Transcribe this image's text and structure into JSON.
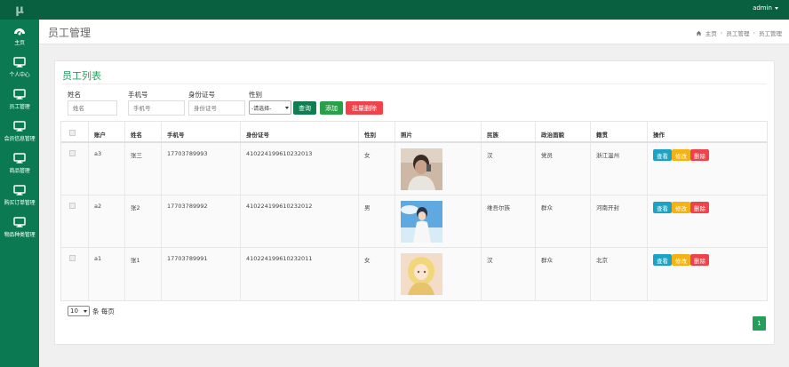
{
  "app": {
    "logo": "μ",
    "user": "admin"
  },
  "sidebar": {
    "items": [
      {
        "label": "主页",
        "icon": "dashboard-icon"
      },
      {
        "label": "个人中心",
        "icon": "monitor-icon"
      },
      {
        "label": "员工管理",
        "icon": "monitor-icon"
      },
      {
        "label": "会员信息管理",
        "icon": "monitor-icon"
      },
      {
        "label": "商品管理",
        "icon": "monitor-icon"
      },
      {
        "label": "购买订单管理",
        "icon": "monitor-icon"
      },
      {
        "label": "物品种类管理",
        "icon": "monitor-icon"
      }
    ]
  },
  "header": {
    "title": "员工管理",
    "breadcrumb": [
      "主页",
      "员工管理",
      "员工管理"
    ]
  },
  "card": {
    "title": "员工列表"
  },
  "filters": {
    "name": {
      "label": "姓名",
      "placeholder": "姓名"
    },
    "phone": {
      "label": "手机号",
      "placeholder": "手机号"
    },
    "idcard": {
      "label": "身份证号",
      "placeholder": "身份证号"
    },
    "gender": {
      "label": "性别",
      "selected": "-请选择-"
    },
    "buttons": {
      "search": "查询",
      "add": "添加",
      "batch_delete": "批量删除"
    }
  },
  "table": {
    "headers": [
      "账户",
      "姓名",
      "手机号",
      "身份证号",
      "性别",
      "照片",
      "民族",
      "政治面貌",
      "籍贯",
      "操作"
    ],
    "rows": [
      {
        "account": "a3",
        "name": "张三",
        "phone": "17703789993",
        "idcard": "410224199610232013",
        "gender": "女",
        "ethnicity": "汉",
        "political": "党员",
        "hometown": "浙江温州"
      },
      {
        "account": "a2",
        "name": "张2",
        "phone": "17703789992",
        "idcard": "410224199610232012",
        "gender": "男",
        "ethnicity": "维吾尔族",
        "political": "群众",
        "hometown": "河南开封"
      },
      {
        "account": "a1",
        "name": "张1",
        "phone": "17703789991",
        "idcard": "410224199610232011",
        "gender": "女",
        "ethnicity": "汉",
        "political": "群众",
        "hometown": "北京"
      }
    ],
    "actions": {
      "view": "查看",
      "edit": "修改",
      "delete": "删除"
    }
  },
  "pagination": {
    "per_page_value": "10",
    "per_page_suffix": "条 每页",
    "current_page": "1"
  },
  "colors": {
    "topbar": "#086040",
    "sidebar": "#0b7a52",
    "title_green": "#2d9e60",
    "btn_search": "#0e7d52",
    "btn_add": "#27a047",
    "btn_delete": "#f0424a",
    "act_view": "#1aa3c4",
    "act_edit": "#f3b316",
    "act_delete": "#f0424a",
    "page_active": "#22a05a"
  }
}
